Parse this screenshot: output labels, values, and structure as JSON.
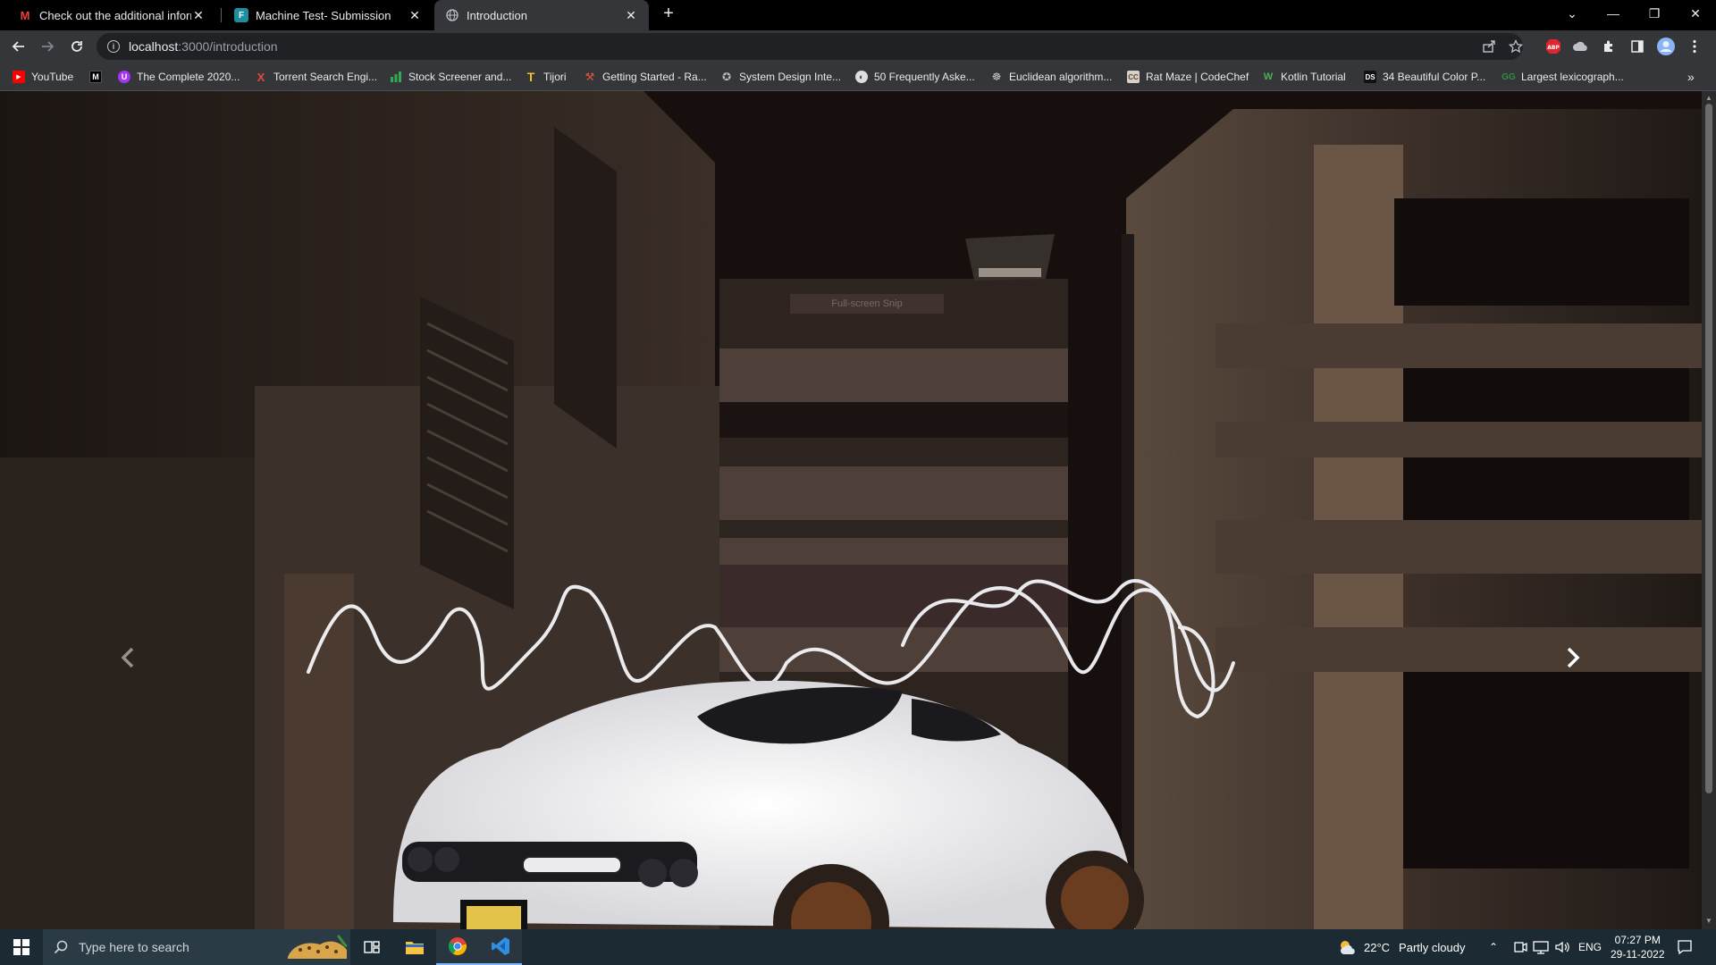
{
  "browser": {
    "tabs": [
      {
        "title": "Check out the additional informa",
        "icon": "gmail-icon",
        "active": false
      },
      {
        "title": "Machine Test- Submission",
        "icon": "form-icon",
        "active": false
      },
      {
        "title": "Introduction",
        "icon": "globe-icon",
        "active": true
      }
    ],
    "new_tab_symbol": "+",
    "window_controls": {
      "minimize": "—",
      "restore": "❐",
      "close": "✕",
      "tab_search": "⌄"
    },
    "address": {
      "host": "localhost",
      "path": ":3000/introduction"
    },
    "bookmarks": [
      {
        "label": "YouTube",
        "icon": "youtube-icon",
        "color": "#ff0000"
      },
      {
        "label": "",
        "icon": "medium-icon",
        "color": "#ffffff"
      },
      {
        "label": "The Complete 2020...",
        "icon": "udemy-icon",
        "color": "#a435f0"
      },
      {
        "label": "Torrent Search Engi...",
        "icon": "torrent-icon",
        "color": "#e8453c"
      },
      {
        "label": "Stock Screener and...",
        "icon": "bars-icon",
        "color": "#34a853"
      },
      {
        "label": "Tijori",
        "icon": "tijori-icon",
        "color": "#f6c02d"
      },
      {
        "label": "Getting Started - Ra...",
        "icon": "rails-icon",
        "color": "#e0593a"
      },
      {
        "label": "System Design Inte...",
        "icon": "github-icon",
        "color": "#bbbbbb"
      },
      {
        "label": "50 Frequently Aske...",
        "icon": "site-icon",
        "color": "#dddddd"
      },
      {
        "label": "Euclidean algorithm...",
        "icon": "wikipedia-icon",
        "color": "#cccccc"
      },
      {
        "label": "Rat Maze | CodeChef",
        "icon": "codechef-icon",
        "color": "#d8d0c4"
      },
      {
        "label": "Kotlin Tutorial",
        "icon": "w3-icon",
        "color": "#4caf50"
      },
      {
        "label": "34 Beautiful Color P...",
        "icon": "ds-icon",
        "color": "#ffffff"
      },
      {
        "label": "Largest lexicograph...",
        "icon": "gfg-icon",
        "color": "#2f8d46"
      }
    ],
    "bookmarks_overflow": "»"
  },
  "page": {
    "caption": "Full-screen Snip",
    "prev_label": "‹",
    "next_label": "›"
  },
  "taskbar": {
    "search_placeholder": "Type here to search",
    "weather": {
      "temp": "22°C",
      "condition": "Partly cloudy"
    },
    "language": "ENG",
    "time": "07:27 PM",
    "date": "29-11-2022"
  }
}
